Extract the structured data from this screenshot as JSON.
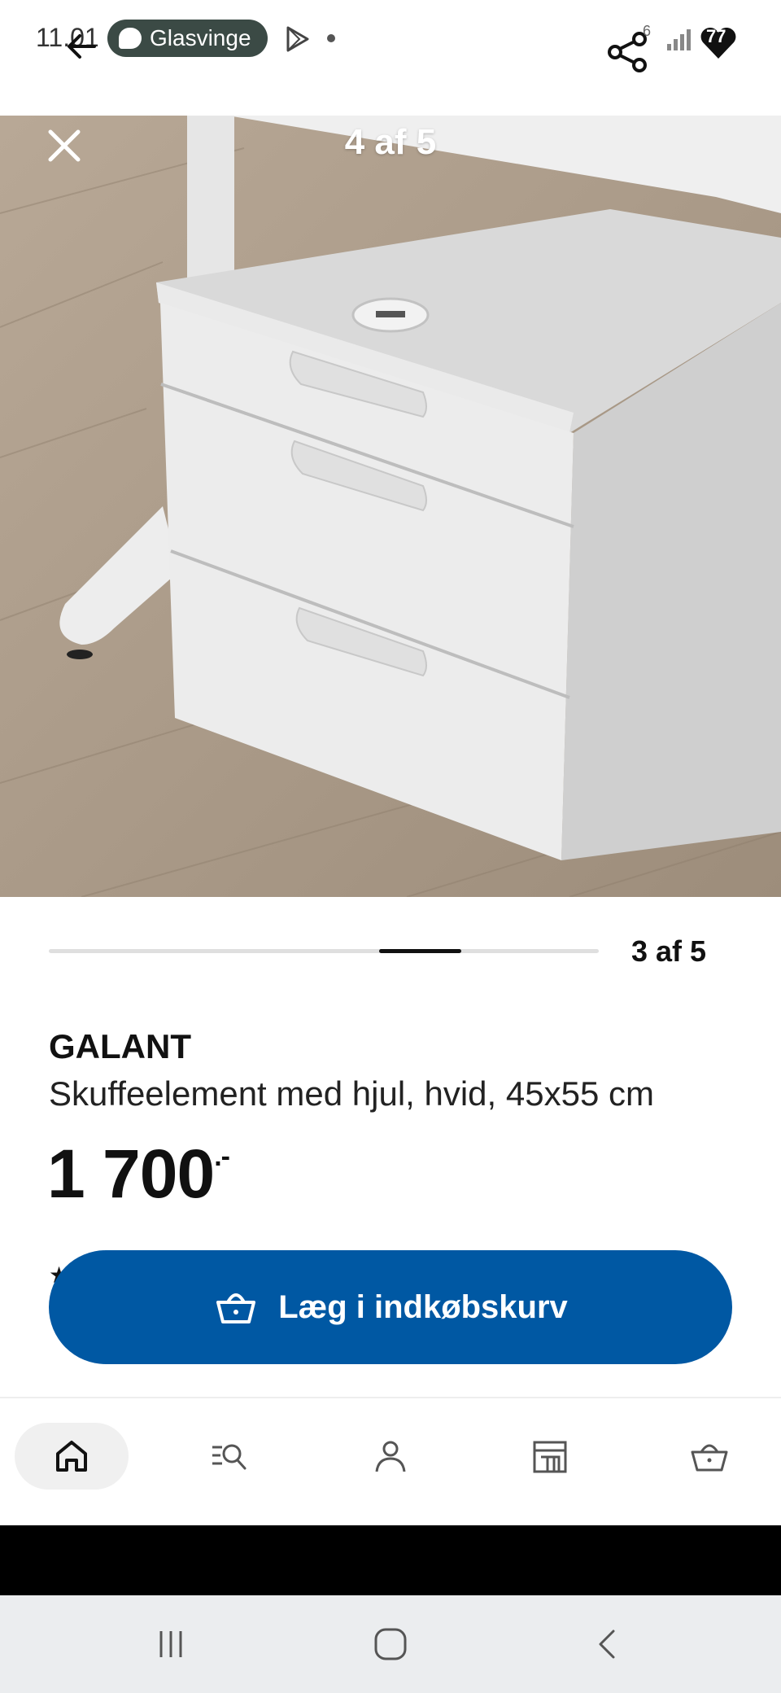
{
  "status_bar": {
    "time": "11.01",
    "notification_label": "Glasvinge",
    "signal_label": "6",
    "badge_count": "77"
  },
  "gallery": {
    "counter_top": "4 af 5",
    "counter_bottom": "3 af 5",
    "progress_fraction_start": 0.6,
    "progress_fraction_end": 0.75
  },
  "product": {
    "brand": "GALANT",
    "description": "Skuffeelement med hjul, hvid, 45x55 cm",
    "price": "1 700",
    "price_suffix": ".-"
  },
  "actions": {
    "add_to_cart_label": "Læg i indkøbskurv"
  },
  "bottom_nav": {
    "items": [
      {
        "icon": "home-icon",
        "active": true
      },
      {
        "icon": "search-list-icon",
        "active": false
      },
      {
        "icon": "profile-icon",
        "active": false
      },
      {
        "icon": "store-icon",
        "active": false
      },
      {
        "icon": "basket-icon",
        "active": false
      }
    ]
  },
  "colors": {
    "accent": "#0058a3",
    "notification_pill": "#3b4a45"
  }
}
